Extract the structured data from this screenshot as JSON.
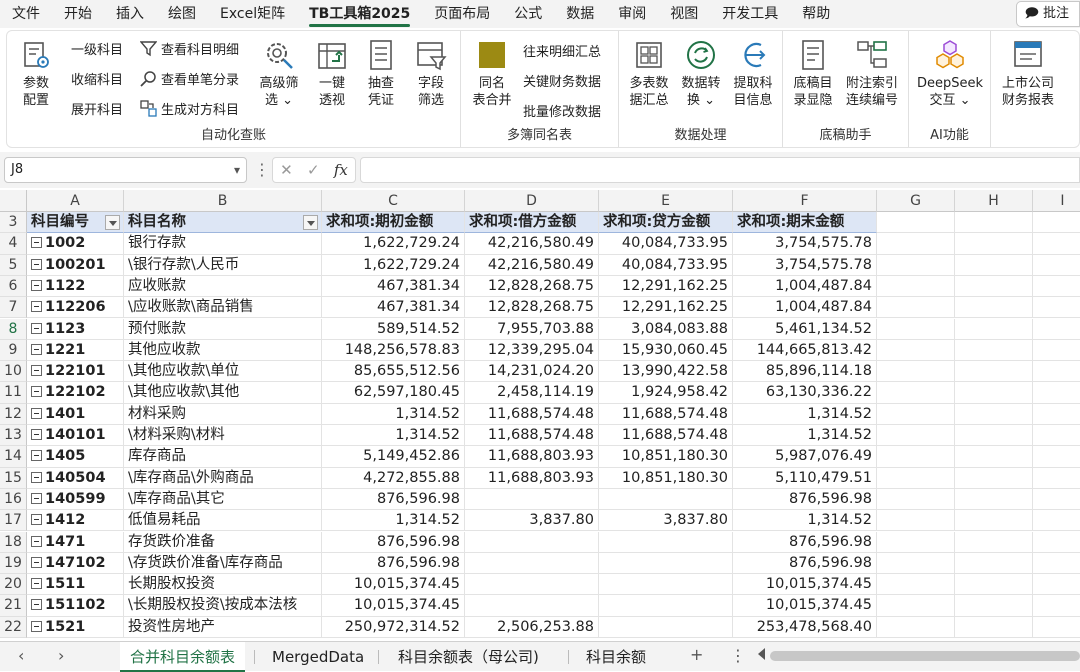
{
  "menu": [
    "文件",
    "开始",
    "插入",
    "绘图",
    "Excel矩阵",
    "TB工具箱2025",
    "页面布局",
    "公式",
    "数据",
    "审阅",
    "视图",
    "开发工具",
    "帮助"
  ],
  "menu_active_index": 5,
  "comment_button": "批注",
  "ribbon": {
    "group1": {
      "label": "自动化查账",
      "param": "参数\n配置",
      "small_a": [
        "一级科目",
        "收缩科目",
        "展开科目"
      ],
      "small_b": [
        "查看科目明细",
        "查看单笔分录",
        "生成对方科目"
      ],
      "advfilter": "高级筛\n选 ⌄",
      "pivot": "一键\n透视",
      "sample": "抽查\n凭证",
      "field": "字段\n筛选"
    },
    "group2": {
      "label": "多簿同名表",
      "merge": "同名\n表合并",
      "small": [
        "往来明细汇总",
        "关键财务数据",
        "批量修改数据"
      ]
    },
    "group3": {
      "label": "数据处理",
      "multi": "多表数\n据汇总",
      "convert": "数据转\n换 ⌄",
      "extract": "提取科\n目信息"
    },
    "group4": {
      "label": "底稿助手",
      "show": "底稿目\n录显隐",
      "note": "附注索引\n连续编号"
    },
    "group5": {
      "label": "AI功能",
      "deepseek": "DeepSeek\n交互 ⌄"
    },
    "group6": {
      "listed": "上市公司\n财务报表"
    }
  },
  "formula_bar": {
    "name_box": "J8",
    "fx": "fx",
    "formula": ""
  },
  "columns": [
    "A",
    "B",
    "C",
    "D",
    "E",
    "F",
    "G",
    "H",
    "I"
  ],
  "header_row_number": "3",
  "table_headers": [
    "科目编号",
    "科目名称",
    "求和项:期初金额",
    "求和项:借方金额",
    "求和项:贷方金额",
    "求和项:期末金额"
  ],
  "selected_row": "8",
  "rows": [
    {
      "n": "4",
      "code": "1002",
      "name": "银行存款",
      "c": "1,622,729.24",
      "d": "42,216,580.49",
      "e": "40,084,733.95",
      "f": "3,754,575.78"
    },
    {
      "n": "5",
      "code": "100201",
      "name": "\\银行存款\\人民币",
      "c": "1,622,729.24",
      "d": "42,216,580.49",
      "e": "40,084,733.95",
      "f": "3,754,575.78"
    },
    {
      "n": "6",
      "code": "1122",
      "name": "应收账款",
      "c": "467,381.34",
      "d": "12,828,268.75",
      "e": "12,291,162.25",
      "f": "1,004,487.84"
    },
    {
      "n": "7",
      "code": "112206",
      "name": "\\应收账款\\商品销售",
      "c": "467,381.34",
      "d": "12,828,268.75",
      "e": "12,291,162.25",
      "f": "1,004,487.84"
    },
    {
      "n": "8",
      "code": "1123",
      "name": "预付账款",
      "c": "589,514.52",
      "d": "7,955,703.88",
      "e": "3,084,083.88",
      "f": "5,461,134.52"
    },
    {
      "n": "9",
      "code": "1221",
      "name": "其他应收款",
      "c": "148,256,578.83",
      "d": "12,339,295.04",
      "e": "15,930,060.45",
      "f": "144,665,813.42"
    },
    {
      "n": "10",
      "code": "122101",
      "name": "\\其他应收款\\单位",
      "c": "85,655,512.56",
      "d": "14,231,024.20",
      "e": "13,990,422.58",
      "f": "85,896,114.18"
    },
    {
      "n": "11",
      "code": "122102",
      "name": "\\其他应收款\\其他",
      "c": "62,597,180.45",
      "d": "2,458,114.19",
      "e": "1,924,958.42",
      "f": "63,130,336.22"
    },
    {
      "n": "12",
      "code": "1401",
      "name": "材料采购",
      "c": "1,314.52",
      "d": "11,688,574.48",
      "e": "11,688,574.48",
      "f": "1,314.52"
    },
    {
      "n": "13",
      "code": "140101",
      "name": "\\材料采购\\材料",
      "c": "1,314.52",
      "d": "11,688,574.48",
      "e": "11,688,574.48",
      "f": "1,314.52"
    },
    {
      "n": "14",
      "code": "1405",
      "name": "库存商品",
      "c": "5,149,452.86",
      "d": "11,688,803.93",
      "e": "10,851,180.30",
      "f": "5,987,076.49"
    },
    {
      "n": "15",
      "code": "140504",
      "name": "\\库存商品\\外购商品",
      "c": "4,272,855.88",
      "d": "11,688,803.93",
      "e": "10,851,180.30",
      "f": "5,110,479.51"
    },
    {
      "n": "16",
      "code": "140599",
      "name": "\\库存商品\\其它",
      "c": "876,596.98",
      "d": "",
      "e": "",
      "f": "876,596.98"
    },
    {
      "n": "17",
      "code": "1412",
      "name": "低值易耗品",
      "c": "1,314.52",
      "d": "3,837.80",
      "e": "3,837.80",
      "f": "1,314.52"
    },
    {
      "n": "18",
      "code": "1471",
      "name": "存货跌价准备",
      "c": "876,596.98",
      "d": "",
      "e": "",
      "f": "876,596.98"
    },
    {
      "n": "19",
      "code": "147102",
      "name": "\\存货跌价准备\\库存商品",
      "c": "876,596.98",
      "d": "",
      "e": "",
      "f": "876,596.98"
    },
    {
      "n": "20",
      "code": "1511",
      "name": "长期股权投资",
      "c": "10,015,374.45",
      "d": "",
      "e": "",
      "f": "10,015,374.45"
    },
    {
      "n": "21",
      "code": "151102",
      "name": "\\长期股权投资\\按成本法核",
      "c": "10,015,374.45",
      "d": "",
      "e": "",
      "f": "10,015,374.45"
    },
    {
      "n": "22",
      "code": "1521",
      "name": "投资性房地产",
      "c": "250,972,314.52",
      "d": "2,506,253.88",
      "e": "",
      "f": "253,478,568.40"
    }
  ],
  "sheet_tabs": [
    "合并科目余额表",
    "MergedData",
    "科目余额表（母公司)",
    "科目余额"
  ],
  "active_tab_index": 0,
  "colors": {
    "accent": "#217346",
    "header_fill": "#dde6f5"
  }
}
